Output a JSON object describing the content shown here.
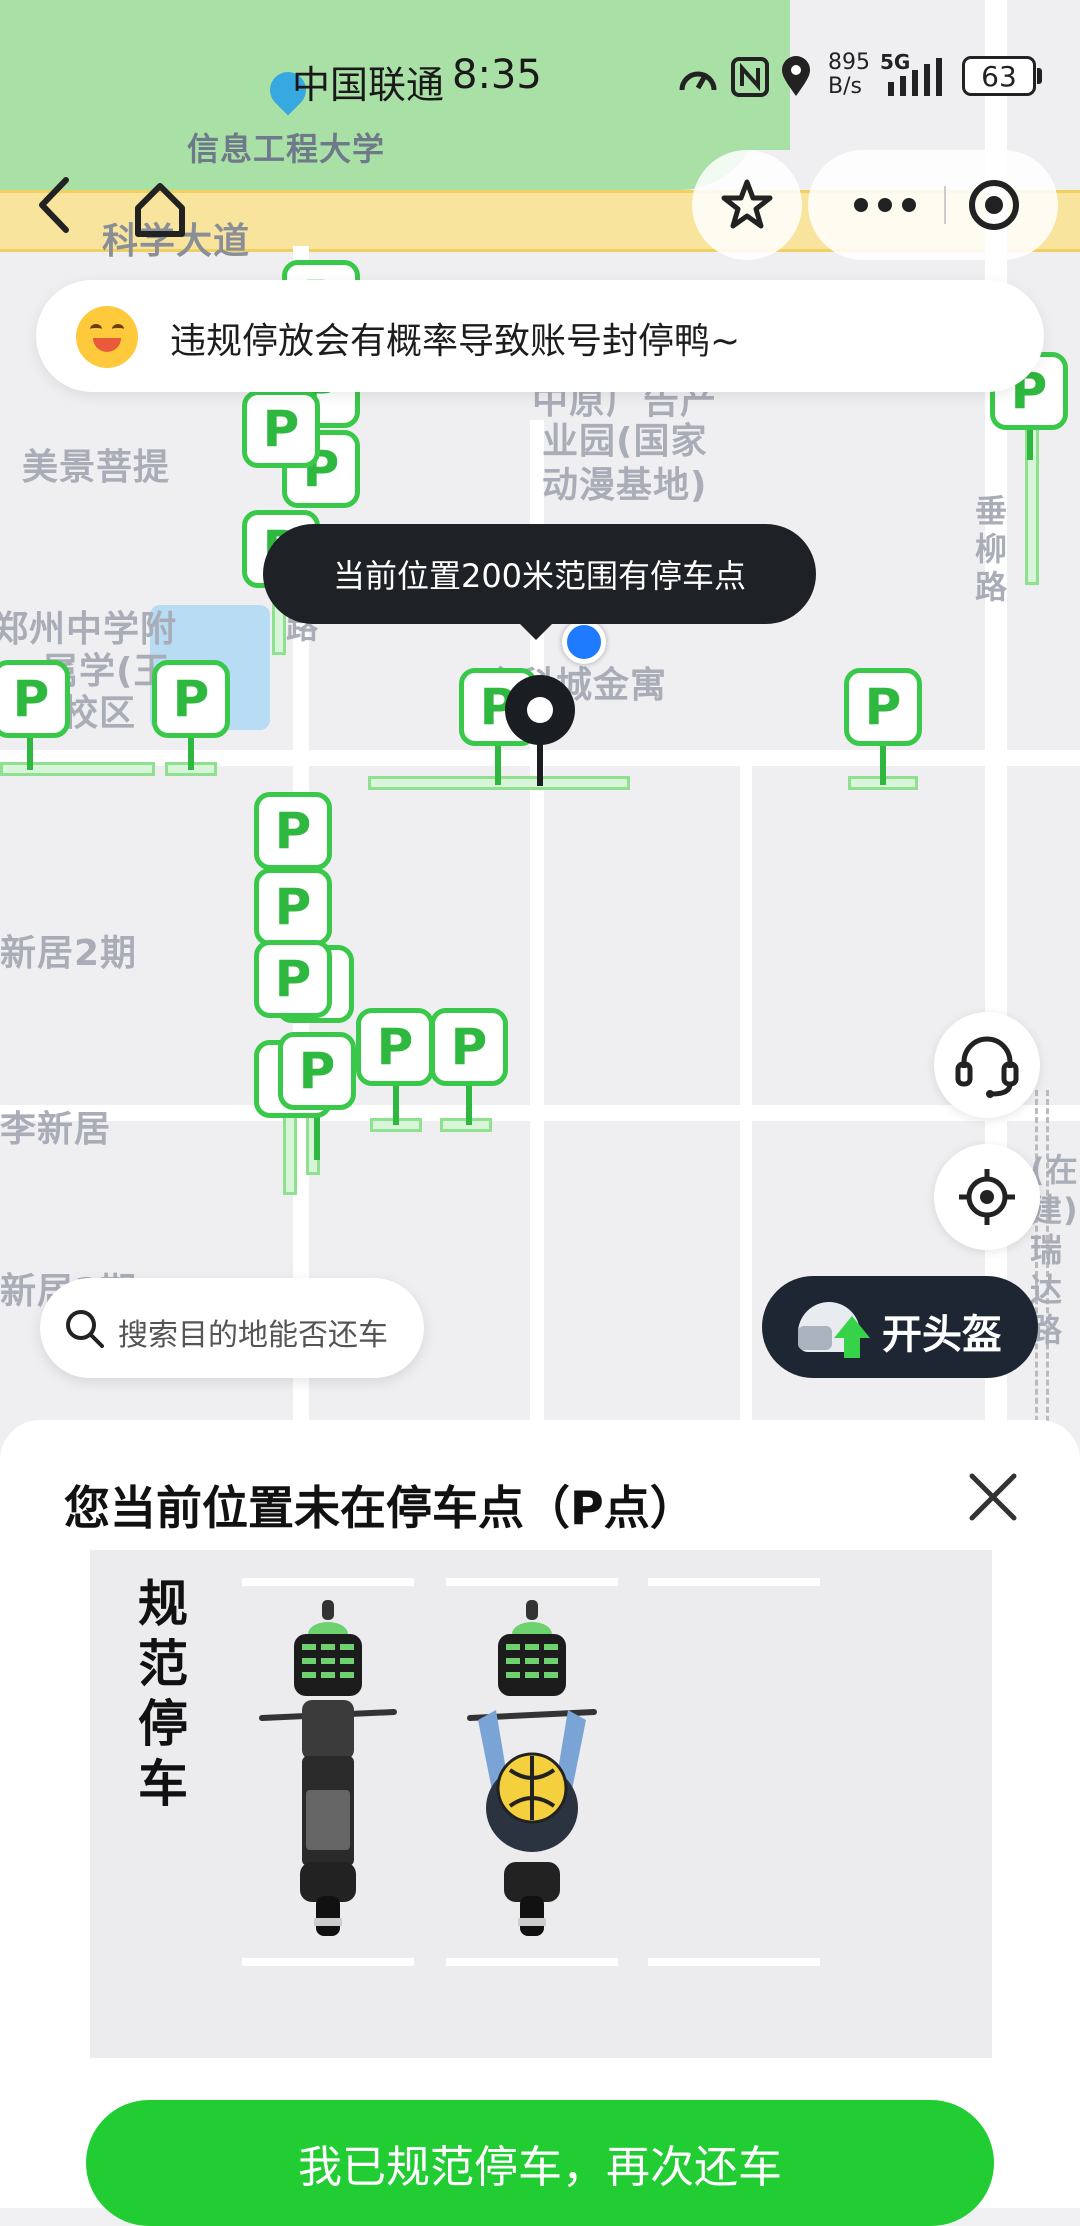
{
  "status_bar": {
    "carrier": "中国联通",
    "time": "8:35",
    "net_speed_top": "895",
    "net_speed_bottom": "B/s",
    "network_type": "5G",
    "battery": "63"
  },
  "map": {
    "labels": {
      "university": "信息工程大学",
      "road_kexue": "科学大道",
      "meijing": "美景菩提",
      "park_line1": "中原广告产",
      "park_line2": "业园(国家",
      "park_line3": "动漫基地)",
      "chuiliu": "垂柳路",
      "school_line1": "郑州中学附",
      "school_line2": "属学(王",
      "school_line3": "校区",
      "jinke": "金科城金寓",
      "xinju2": "新居2期",
      "lixinju": "李新居",
      "xinju1": "新居1期",
      "ruida": "(在建)瑞达路",
      "road_short": "路"
    },
    "parking_letter": "P"
  },
  "header": {
    "icons": [
      "back-icon",
      "home-icon",
      "star-icon",
      "more-icon",
      "target-icon"
    ]
  },
  "notice": {
    "text": "违规停放会有概率导致账号封停鸭~",
    "emoji_icon": "smile-emoji-icon"
  },
  "tooltip": {
    "text": "当前位置200米范围有停车点"
  },
  "search": {
    "placeholder": "搜索目的地能否还车"
  },
  "helmet_button": {
    "label": "开头盔"
  },
  "sheet": {
    "title": "您当前位置未在停车点（P点）",
    "diagram_label": "规范停车",
    "confirm_button": "我已规范停车，再次还车"
  },
  "colors": {
    "brand_green": "#22cc33",
    "parking_green": "#39c84a",
    "dark_navy": "#1e2633",
    "location_blue": "#1e7bff"
  }
}
